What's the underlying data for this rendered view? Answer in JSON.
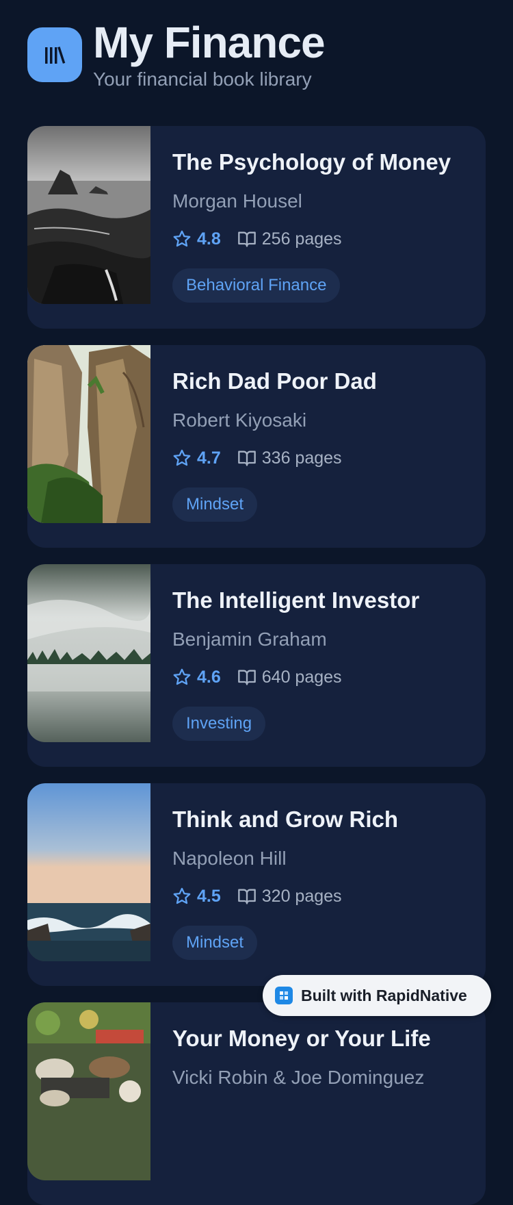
{
  "header": {
    "title": "My Finance",
    "subtitle": "Your financial book library",
    "logo_icon": "library-icon"
  },
  "books": [
    {
      "title": "The Psychology of Money",
      "author": "Morgan Housel",
      "rating": "4.8",
      "pages": "256 pages",
      "tag": "Behavioral Finance"
    },
    {
      "title": "Rich Dad Poor Dad",
      "author": "Robert Kiyosaki",
      "rating": "4.7",
      "pages": "336 pages",
      "tag": "Mindset"
    },
    {
      "title": "The Intelligent Investor",
      "author": "Benjamin Graham",
      "rating": "4.6",
      "pages": "640 pages",
      "tag": "Investing"
    },
    {
      "title": "Think and Grow Rich",
      "author": "Napoleon Hill",
      "rating": "4.5",
      "pages": "320 pages",
      "tag": "Mindset"
    },
    {
      "title": "Your Money or Your Life",
      "author": "Vicki Robin & Joe Dominguez"
    }
  ],
  "badge": {
    "label": "Built with RapidNative"
  },
  "colors": {
    "background": "#0c1629",
    "card": "#15213d",
    "accent": "#5fa3f5",
    "tag_bg": "#1d2d4e"
  }
}
